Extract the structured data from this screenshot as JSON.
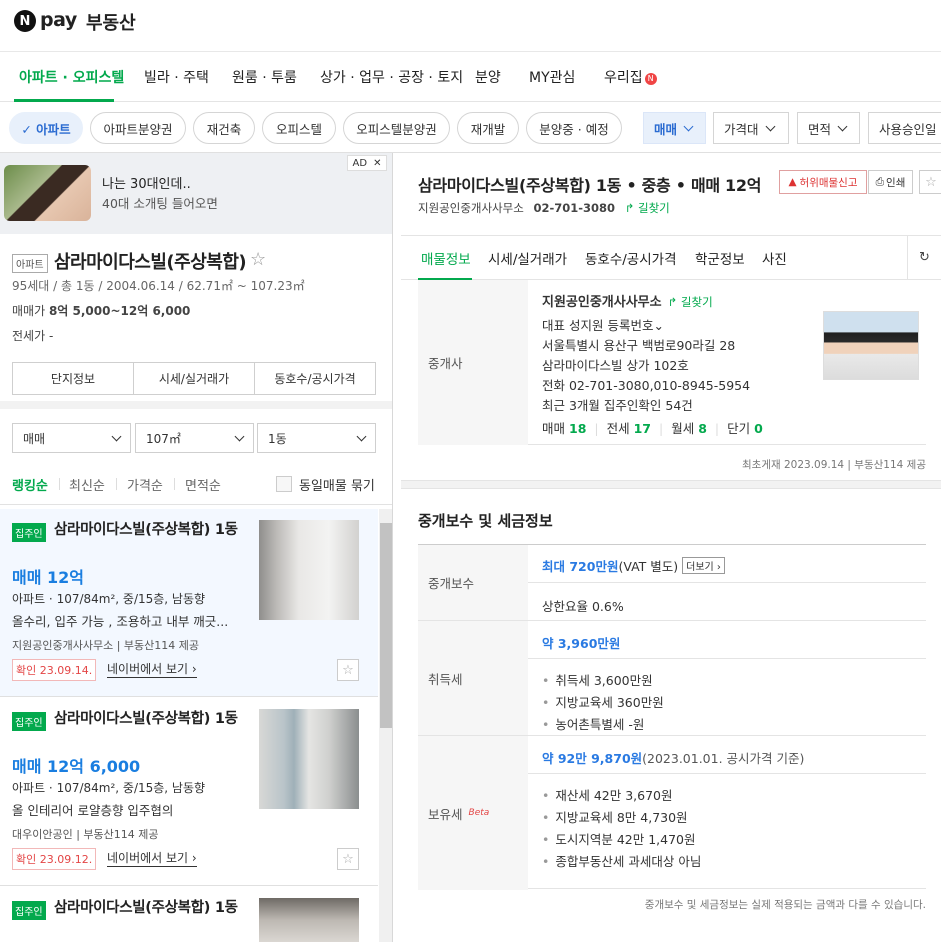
{
  "header": {
    "logo_n": "N",
    "logo_pay": "pay",
    "logo_realestate": "부동산"
  },
  "gnb": {
    "items": [
      "아파트 · 오피스텔",
      "빌라 · 주택",
      "원룸 · 투룸",
      "상가 · 업무 · 공장 · 토지",
      "분양",
      "MY관심",
      "우리집"
    ],
    "new_badge": "N"
  },
  "filters": {
    "chips": [
      "✓ 아파트",
      "아파트분양권",
      "재건축",
      "오피스텔",
      "오피스텔분양권",
      "재개발",
      "분양중 · 예정"
    ],
    "selects": [
      "매매",
      "가격대",
      "면적",
      "사용승인일"
    ]
  },
  "ad": {
    "title": "나는 30대인데..",
    "subtitle": "40대 소개팅 들어오면",
    "mark": "AD",
    "close": "✕"
  },
  "complex": {
    "badge": "아파트",
    "name": "삼라마이다스빌(주상복합)",
    "meta": "95세대 / 총 1동 / 2004.06.14 / 62.71㎡ ~ 107.23㎡",
    "sale_label": "매매가",
    "sale_value": "8억 5,000~12억 6,000",
    "jeonse_label": "전세가",
    "jeonse_value": "-",
    "tabs": [
      "단지정보",
      "시세/실거래가",
      "동호수/공시가격"
    ]
  },
  "list_filters": {
    "type": "매매",
    "area": "107㎡",
    "dong": "1동"
  },
  "sort": {
    "options": [
      "랭킹순",
      "최신순",
      "가격순",
      "면적순"
    ],
    "dedupe": "동일매물 묶기"
  },
  "listings": [
    {
      "owner": "집주인",
      "title": "삼라마이다스빌(주상복합) 1동",
      "price": "매매 12억",
      "spec": "아파트 · 107/84m², 중/15층, 남동향",
      "desc": "올수리, 입주 가능 , 조용하고 내부 깨긋...",
      "agent": "지원공인중개사사무소 | 부동산114 제공",
      "confirm": "확인 23.09.14.",
      "naver": "네이버에서 보기 ›"
    },
    {
      "owner": "집주인",
      "title": "삼라마이다스빌(주상복합) 1동",
      "price": "매매 12억 6,000",
      "spec": "아파트 · 107/84m², 중/15층, 남동향",
      "desc": "올 인테리어 로얄층향 입주협의",
      "agent": "대우이안공인 | 부동산114 제공",
      "confirm": "확인 23.09.12.",
      "naver": "네이버에서 보기 ›"
    },
    {
      "owner": "집주인",
      "title": "삼라마이다스빌(주상복합) 1동"
    }
  ],
  "detail": {
    "title": "삼라마이다스빌(주상복합) 1동 • 중층 • 매매 12억",
    "report": "허위매물신고",
    "print": "인쇄",
    "agent_name": "지원공인중개사사무소",
    "agent_phone": "02-701-3080",
    "directions": "길찾기",
    "tabs": [
      "매물정보",
      "시세/실거래가",
      "동호수/공시가격",
      "학군정보",
      "사진"
    ],
    "refresh_icon": "↻"
  },
  "agent_box": {
    "label": "중개사",
    "name": "지원공인중개사사무소",
    "directions": "길찾기",
    "rep": "대표 성지원 등록번호⌄",
    "address": "서울특별시 용산구 백범로90라길 28",
    "building": "삼라마이다스빌 상가 102호",
    "phone": "전화 02-701-3080,010-8945-5954",
    "recent": "최근 3개월 집주인확인 54건",
    "counts": [
      {
        "label": "매매",
        "value": "18"
      },
      {
        "label": "전세",
        "value": "17"
      },
      {
        "label": "월세",
        "value": "8"
      },
      {
        "label": "단기",
        "value": "0"
      }
    ],
    "first_post": "최초게재 2023.09.14 | 부동산114 제공"
  },
  "fees": {
    "title": "중개보수 및 세금정보",
    "brokerage_label": "중개보수",
    "brokerage_max": "최대 720만원",
    "brokerage_vat": "(VAT 별도)",
    "more": "더보기 ›",
    "rate": "상한요율  0.6%",
    "acq_label": "취득세",
    "acq_total": "약 3,960만원",
    "acq_items": [
      "취득세 3,600만원",
      "지방교육세 360만원",
      "농어촌특별세 -원"
    ],
    "hold_label": "보유세",
    "hold_beta": "Beta",
    "hold_total": "약 92만 9,870원",
    "hold_basis": "(2023.01.01. 공시가격 기준)",
    "hold_items": [
      "재산세 42만 3,670원",
      "지방교육세 8만 4,730원",
      "도시지역분 42만 1,470원",
      "종합부동산세 과세대상 아님"
    ],
    "note": "중개보수 및 세금정보는 실제 적용되는 금액과 다를 수 있습니다."
  }
}
